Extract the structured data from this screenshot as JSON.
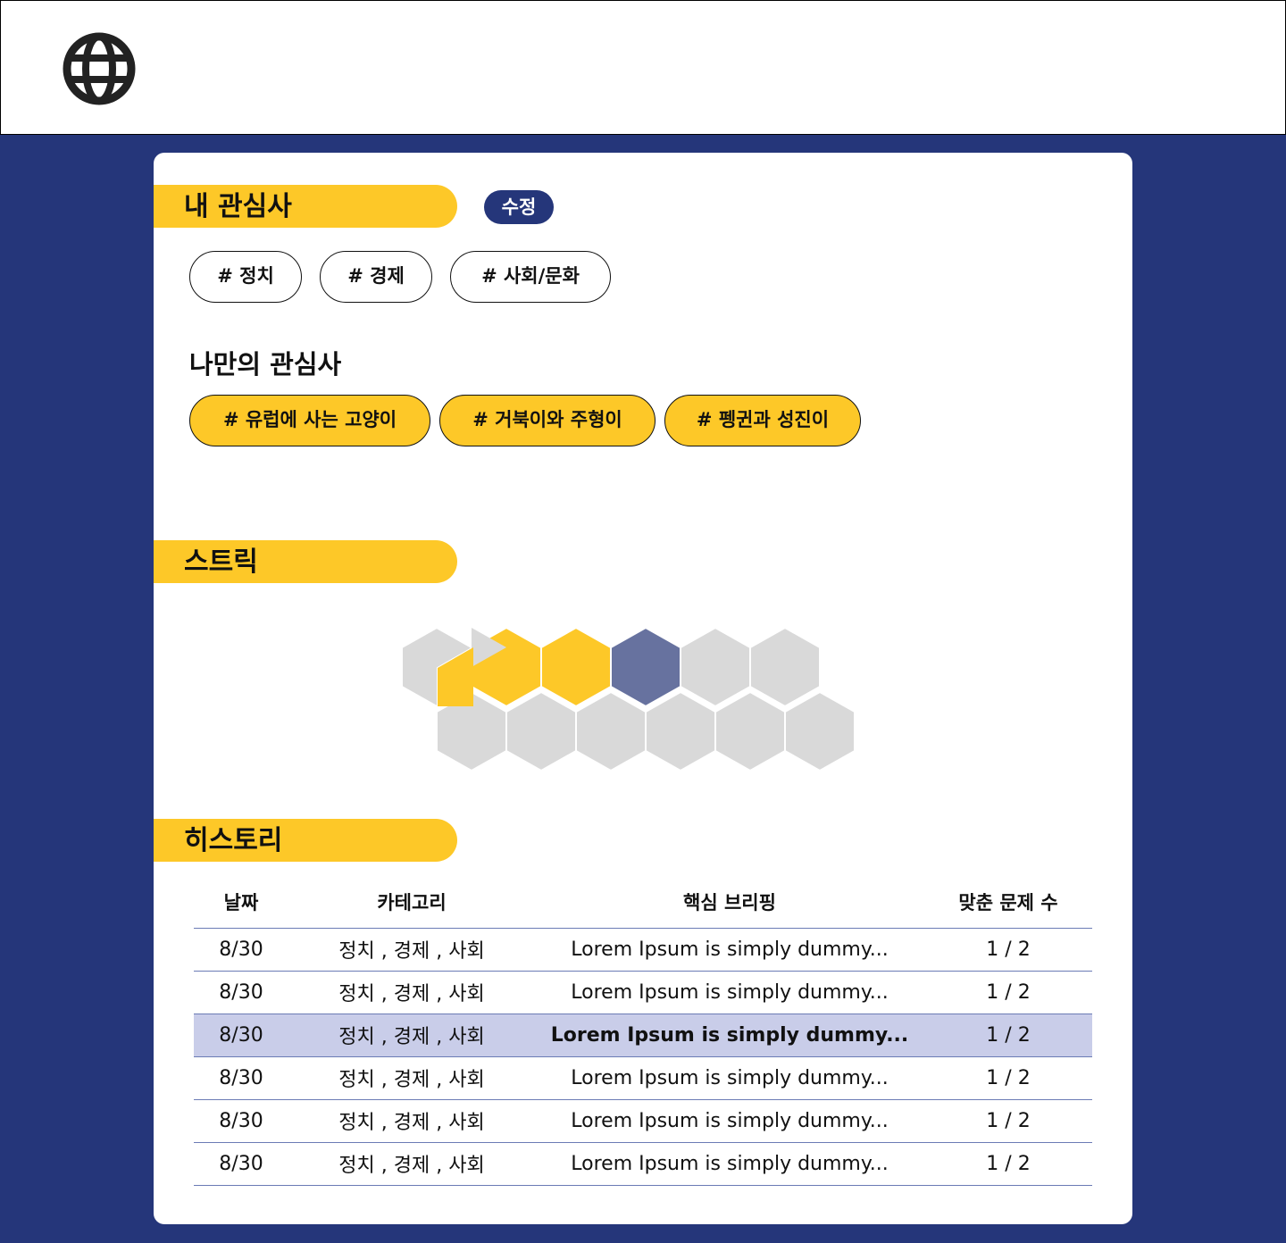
{
  "header": {
    "logo_icon": "globe-icon"
  },
  "interests": {
    "title": "내 관심사",
    "edit_label": "수정",
    "tags": [
      "# 정치",
      "# 경제",
      "# 사회/문화"
    ]
  },
  "my_interests": {
    "title": "나만의 관심사",
    "tags": [
      "# 유럽에 사는 고양이",
      "# 거북이와 주형이",
      "# 펭귄과 성진이"
    ]
  },
  "streak": {
    "title": "스트릭",
    "colors": {
      "empty": "#d9d9d9",
      "active": "#fdc828",
      "current": "#67729f"
    }
  },
  "history": {
    "title": "히스토리",
    "columns": [
      "날짜",
      "카테고리",
      "핵심 브리핑",
      "맞춘 문제 수"
    ],
    "rows": [
      {
        "date": "8/30",
        "category": "정치 , 경제 , 사회",
        "brief": "Lorem Ipsum is simply dummy...",
        "score": "1 / 2"
      },
      {
        "date": "8/30",
        "category": "정치 , 경제 , 사회",
        "brief": "Lorem Ipsum is simply dummy...",
        "score": "1 / 2"
      },
      {
        "date": "8/30",
        "category": "정치 , 경제 , 사회",
        "brief": "Lorem Ipsum is simply dummy...",
        "score": "1 / 2"
      },
      {
        "date": "8/30",
        "category": "정치 , 경제 , 사회",
        "brief": "Lorem Ipsum is simply dummy...",
        "score": "1 / 2"
      },
      {
        "date": "8/30",
        "category": "정치 , 경제 , 사회",
        "brief": "Lorem Ipsum is simply dummy...",
        "score": "1 / 2"
      },
      {
        "date": "8/30",
        "category": "정치 , 경제 , 사회",
        "brief": "Lorem Ipsum is simply dummy...",
        "score": "1 / 2"
      }
    ],
    "highlight_color": "#c9cde9"
  }
}
